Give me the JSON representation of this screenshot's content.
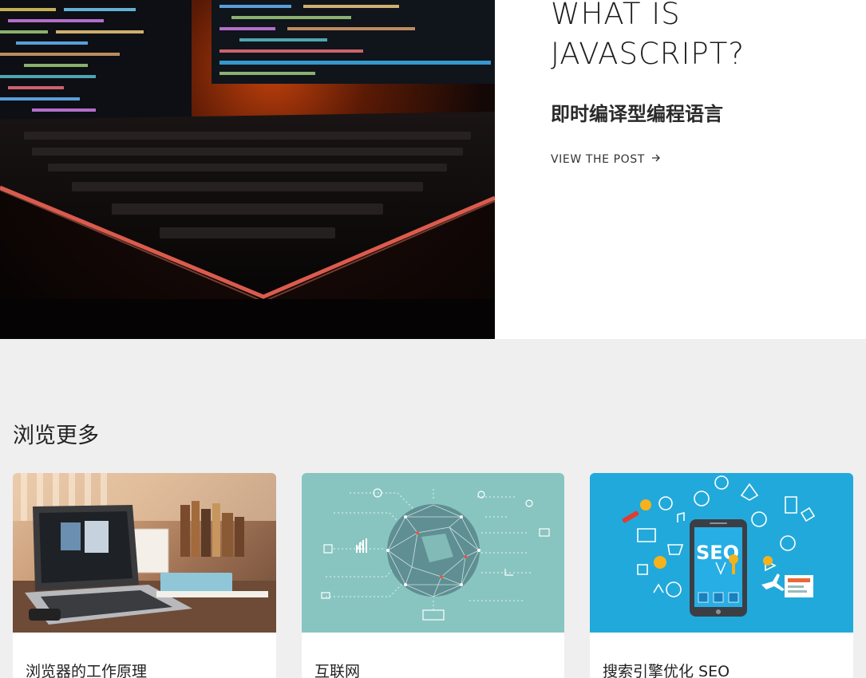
{
  "hero": {
    "title_line1": "WHAT IS",
    "title_line2": "JAVASCRIPT?",
    "subtitle": "即时编译型编程语言",
    "link_label": "VIEW THE POST",
    "link_icon": "arrow-right-icon",
    "image": "code-monitor-keyboard-photo"
  },
  "browse": {
    "title": "浏览更多",
    "cards": [
      {
        "title": "浏览器的工作原理",
        "image": "laptop-desk-photo"
      },
      {
        "title": "互联网",
        "image": "network-globe-illustration"
      },
      {
        "title": "搜索引擎优化 SEO",
        "image": "seo-phone-illustration",
        "image_text": "SEO"
      }
    ]
  },
  "colors": {
    "page_bg": "#efefef",
    "hero_bg": "#ffffff",
    "net_bg": "#88c5c1",
    "seo_bg": "#22a9db"
  }
}
